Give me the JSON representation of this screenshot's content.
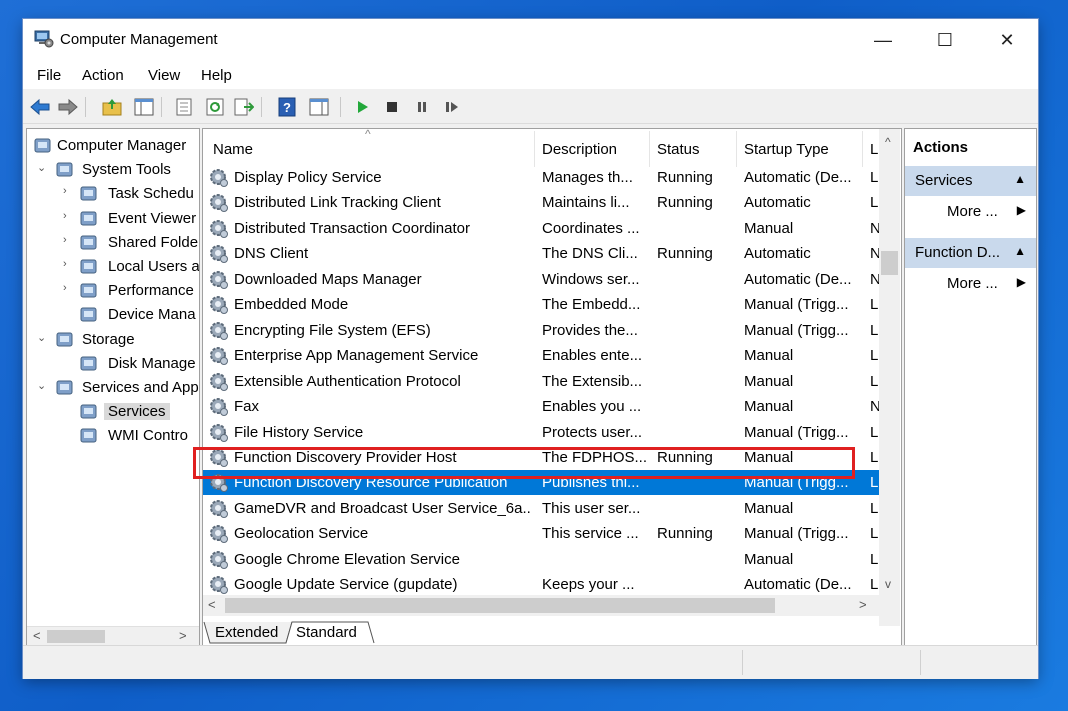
{
  "window": {
    "title": "Computer Management",
    "controls": {
      "minimize": "—",
      "maximize": "☐",
      "close": "✕"
    }
  },
  "menu": [
    "File",
    "Action",
    "View",
    "Help"
  ],
  "toolbar": {
    "icons": [
      "back-arrow-icon",
      "forward-arrow-icon",
      "up-folder-icon",
      "show-tree-icon",
      "properties-icon",
      "refresh-icon",
      "export-list-icon",
      "help-icon",
      "action-pane-icon",
      "start-icon",
      "stop-icon",
      "pause-icon",
      "restart-icon"
    ]
  },
  "tree": [
    {
      "label": "Computer Manager",
      "level": 0,
      "expander": "",
      "icon": "computer-icon"
    },
    {
      "label": "System Tools",
      "level": 1,
      "expander": "⌄",
      "icon": "tools-icon"
    },
    {
      "label": "Task Schedu",
      "level": 2,
      "expander": "›",
      "icon": "clock-icon"
    },
    {
      "label": "Event Viewer",
      "level": 2,
      "expander": "›",
      "icon": "event-viewer-icon"
    },
    {
      "label": "Shared Folde",
      "level": 2,
      "expander": "›",
      "icon": "shared-folder-icon"
    },
    {
      "label": "Local Users a",
      "level": 2,
      "expander": "›",
      "icon": "users-icon"
    },
    {
      "label": "Performance",
      "level": 2,
      "expander": "›",
      "icon": "performance-icon"
    },
    {
      "label": "Device Mana",
      "level": 2,
      "expander": "",
      "icon": "device-manager-icon"
    },
    {
      "label": "Storage",
      "level": 1,
      "expander": "⌄",
      "icon": "storage-icon"
    },
    {
      "label": "Disk Manage",
      "level": 2,
      "expander": "",
      "icon": "disk-icon"
    },
    {
      "label": "Services and App",
      "level": 1,
      "expander": "⌄",
      "icon": "services-apps-icon"
    },
    {
      "label": "Services",
      "level": 2,
      "expander": "",
      "icon": "gear-icon",
      "selected": true
    },
    {
      "label": "WMI Contro",
      "level": 2,
      "expander": "",
      "icon": "wmi-icon"
    }
  ],
  "tree_scroll": {
    "left": "<",
    "right": ">"
  },
  "list": {
    "sort_indicator": "^",
    "columns": [
      "Name",
      "Description",
      "Status",
      "Startup Type",
      "L"
    ],
    "rows": [
      {
        "name": "Display Policy Service",
        "description": "Manages th...",
        "status": "Running",
        "startup": "Automatic (De...",
        "logon": "L"
      },
      {
        "name": "Distributed Link Tracking Client",
        "description": "Maintains li...",
        "status": "Running",
        "startup": "Automatic",
        "logon": "L"
      },
      {
        "name": "Distributed Transaction Coordinator",
        "description": "Coordinates ...",
        "status": "",
        "startup": "Manual",
        "logon": "N"
      },
      {
        "name": "DNS Client",
        "description": "The DNS Cli...",
        "status": "Running",
        "startup": "Automatic",
        "logon": "N"
      },
      {
        "name": "Downloaded Maps Manager",
        "description": "Windows ser...",
        "status": "",
        "startup": "Automatic (De...",
        "logon": "N"
      },
      {
        "name": "Embedded Mode",
        "description": "The Embedd...",
        "status": "",
        "startup": "Manual (Trigg...",
        "logon": "L"
      },
      {
        "name": "Encrypting File System (EFS)",
        "description": "Provides the...",
        "status": "",
        "startup": "Manual (Trigg...",
        "logon": "L"
      },
      {
        "name": "Enterprise App Management Service",
        "description": "Enables ente...",
        "status": "",
        "startup": "Manual",
        "logon": "L"
      },
      {
        "name": "Extensible Authentication Protocol",
        "description": "The Extensib...",
        "status": "",
        "startup": "Manual",
        "logon": "L"
      },
      {
        "name": "Fax",
        "description": "Enables you ...",
        "status": "",
        "startup": "Manual",
        "logon": "N"
      },
      {
        "name": "File History Service",
        "description": "Protects user...",
        "status": "",
        "startup": "Manual (Trigg...",
        "logon": "L"
      },
      {
        "name": "Function Discovery Provider Host",
        "description": "The FDPHOS...",
        "status": "Running",
        "startup": "Manual",
        "logon": "L"
      },
      {
        "name": "Function Discovery Resource Publication",
        "description": "Publishes thi...",
        "status": "",
        "startup": "Manual (Trigg...",
        "logon": "L",
        "selected": true
      },
      {
        "name": "GameDVR and Broadcast User Service_6a...",
        "description": "This user ser...",
        "status": "",
        "startup": "Manual",
        "logon": "L"
      },
      {
        "name": "Geolocation Service",
        "description": "This service ...",
        "status": "Running",
        "startup": "Manual (Trigg...",
        "logon": "L"
      },
      {
        "name": "Google Chrome Elevation Service",
        "description": "",
        "status": "",
        "startup": "Manual",
        "logon": "L"
      },
      {
        "name": "Google Update Service (gupdate)",
        "description": "Keeps your ...",
        "status": "",
        "startup": "Automatic (De...",
        "logon": "L"
      }
    ],
    "vscroll": {
      "up": "^",
      "down": "v"
    },
    "hscroll": {
      "left": "<",
      "right": ">"
    },
    "tabs": [
      "Extended",
      "Standard"
    ],
    "active_tab": "Standard"
  },
  "actions": {
    "title": "Actions",
    "groups": [
      {
        "label": "Services",
        "collapse": "▲",
        "items": [
          {
            "label": "More ...",
            "arrow": "▶"
          }
        ]
      },
      {
        "label": "Function D...",
        "collapse": "▲",
        "items": [
          {
            "label": "More ...",
            "arrow": "▶"
          }
        ]
      }
    ]
  },
  "colors": {
    "selection": "#0078d7",
    "highlight_box": "#e02020",
    "action_group_bg": "#c9d9ec"
  }
}
